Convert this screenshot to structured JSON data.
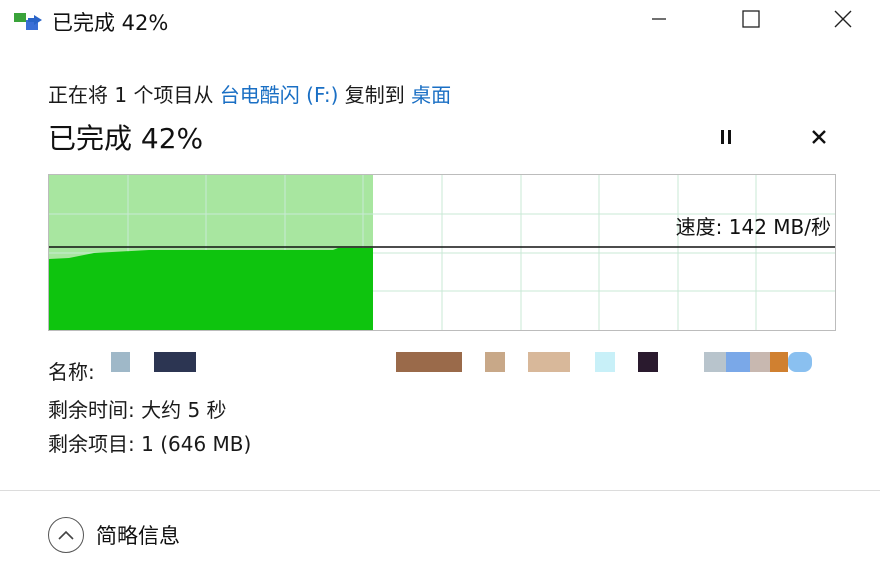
{
  "window": {
    "title": "已完成 42%",
    "app_icon": "copy-transfer-icon",
    "controls": [
      "minimize-icon",
      "maximize-icon",
      "close-icon"
    ]
  },
  "copy_line": {
    "prefix": "正在将 1 个项目从 ",
    "source": "台电酷闪 (F:)",
    "middle": " 复制到 ",
    "destination": "桌面"
  },
  "status": {
    "text": "已完成 42%",
    "percent": 42,
    "pause_icon": "pause-icon",
    "cancel_icon": "cancel-icon"
  },
  "graph": {
    "speed_label": "速度: 142 MB/秒",
    "progress_fraction": 0.42,
    "fill_color": "#0ec40e",
    "done_bg_color": "#a8e6a0",
    "grid_color": "#c9e9d6"
  },
  "details": {
    "name_label": "名称:",
    "remaining_time_label": "剩余时间:",
    "remaining_time_value": "大约 5 秒",
    "remaining_items_label": "剩余项目:",
    "remaining_items_value": "1 (646 MB)"
  },
  "footer": {
    "toggle_icon": "chevron-up-icon",
    "label": "简略信息"
  }
}
